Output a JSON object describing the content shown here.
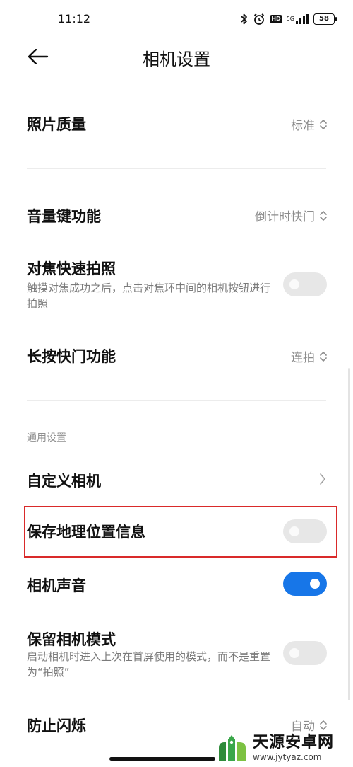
{
  "status_bar": {
    "time": "11:12",
    "network_label": "5G",
    "battery": "58"
  },
  "header": {
    "title": "相机设置"
  },
  "settings": {
    "photo_quality": {
      "label": "照片质量",
      "value": "标准"
    },
    "volume_key": {
      "label": "音量键功能",
      "value": "倒计时快门"
    },
    "focus_shoot": {
      "label": "对焦快速拍照",
      "desc": "触摸对焦成功之后，点击对焦环中间的相机按钮进行拍照",
      "enabled": false
    },
    "long_press": {
      "label": "长按快门功能",
      "value": "连拍"
    },
    "general_section": "通用设置",
    "custom_camera": {
      "label": "自定义相机"
    },
    "save_location": {
      "label": "保存地理位置信息",
      "enabled": false
    },
    "camera_sound": {
      "label": "相机声音",
      "enabled": true
    },
    "keep_mode": {
      "label": "保留相机模式",
      "desc": "启动相机时进入上次在首屏使用的模式，而不是重置为“拍照”",
      "enabled": false
    },
    "anti_flicker": {
      "label": "防止闪烁",
      "value": "自动"
    }
  },
  "watermark": {
    "name": "天源安卓网",
    "url": "www.jytyaz.com"
  },
  "colors": {
    "accent": "#1776e8",
    "highlight": "#d92a2a",
    "toggle_off": "#e7e7e7"
  }
}
